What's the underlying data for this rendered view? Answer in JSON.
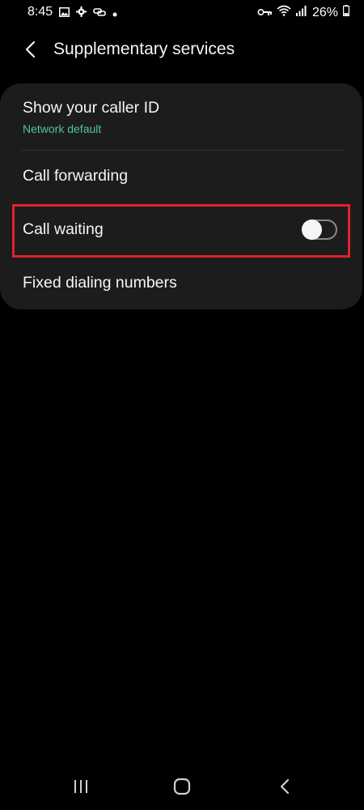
{
  "status_bar": {
    "time": "8:45",
    "battery": "26%",
    "left_icons": [
      "gallery-icon",
      "gear-icon",
      "link-icon",
      "dot-icon"
    ],
    "right_icons": [
      "key-icon",
      "wifi-icon",
      "signal-icon",
      "battery-icon"
    ]
  },
  "header": {
    "title": "Supplementary services"
  },
  "settings": {
    "items": [
      {
        "label": "Show your caller ID",
        "subtitle": "Network default"
      },
      {
        "label": "Call forwarding"
      },
      {
        "label": "Call waiting",
        "toggle_on": false
      },
      {
        "label": "Fixed dialing numbers"
      }
    ]
  },
  "nav": {
    "buttons": [
      "recent-apps-icon",
      "home-icon",
      "back-icon"
    ]
  },
  "colors": {
    "background": "#000000",
    "card": "#1c1c1c",
    "accent_green": "#4fc59a",
    "highlight_red": "#e1222a"
  }
}
